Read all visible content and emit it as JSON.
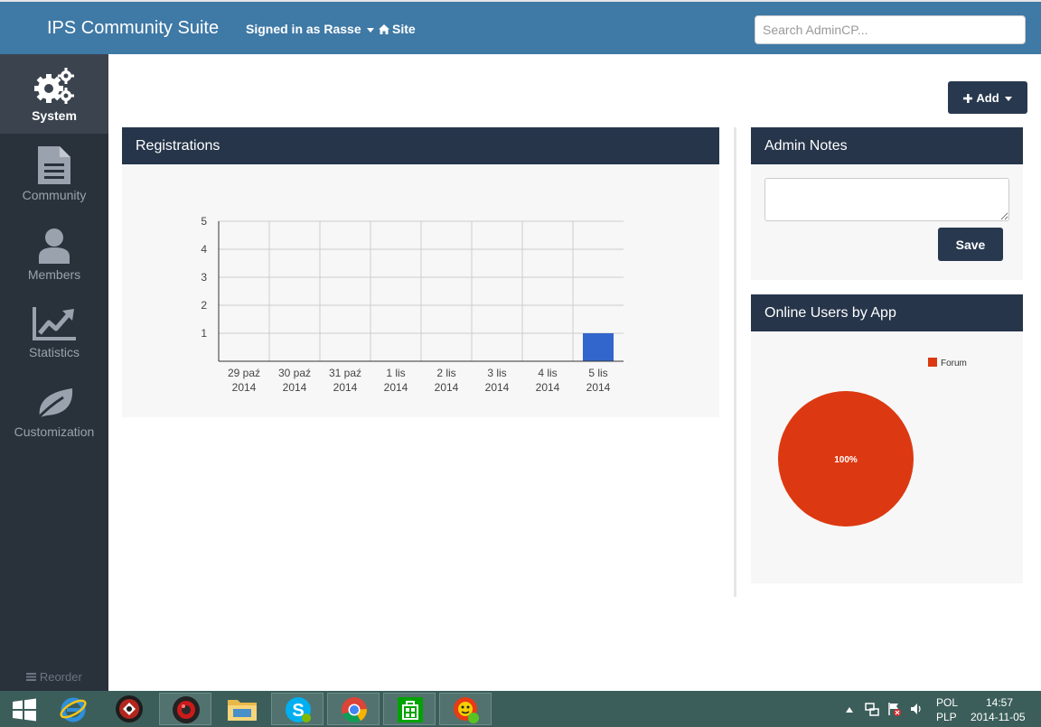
{
  "header": {
    "app_title": "IPS Community Suite",
    "signed_in": "Signed in as Rasse",
    "site_link": "Site",
    "search_placeholder": "Search AdminCP..."
  },
  "sidebar": {
    "items": [
      {
        "label": "System",
        "icon": "gear-icon",
        "active": true
      },
      {
        "label": "Community",
        "icon": "document-icon",
        "active": false
      },
      {
        "label": "Members",
        "icon": "user-icon",
        "active": false
      },
      {
        "label": "Statistics",
        "icon": "chart-icon",
        "active": false
      },
      {
        "label": "Customization",
        "icon": "leaf-icon",
        "active": false
      }
    ],
    "reorder": "Reorder"
  },
  "toolbar": {
    "add_label": "Add"
  },
  "registrations": {
    "title": "Registrations"
  },
  "admin_notes": {
    "title": "Admin Notes",
    "save_label": "Save",
    "value": ""
  },
  "online_users": {
    "title": "Online Users by App"
  },
  "chart_data": [
    {
      "type": "bar",
      "categories": [
        "29 paź 2014",
        "30 paź 2014",
        "31 paź 2014",
        "1 lis 2014",
        "2 lis 2014",
        "3 lis 2014",
        "4 lis 2014",
        "5 lis 2014"
      ],
      "values": [
        0,
        0,
        0,
        0,
        0,
        0,
        0,
        1
      ],
      "yticks": [
        1,
        2,
        3,
        4,
        5
      ],
      "ylim": [
        0,
        5
      ],
      "grid": true,
      "color": "#3366cc"
    },
    {
      "type": "pie",
      "labels": [
        "Forum"
      ],
      "values": [
        100
      ],
      "slice_labels": [
        "100%"
      ],
      "colors": [
        "#dc3912"
      ],
      "legend": "top-right"
    }
  ],
  "taskbar": {
    "apps": [
      "windows-start-icon",
      "internet-explorer-icon",
      "game-app-icon",
      "media-app-icon",
      "file-explorer-icon",
      "skype-icon",
      "chrome-icon",
      "store-icon",
      "sun-app-icon"
    ],
    "lang_top": "POL",
    "lang_bottom": "PLP",
    "time": "14:57",
    "date": "2014-11-05"
  }
}
